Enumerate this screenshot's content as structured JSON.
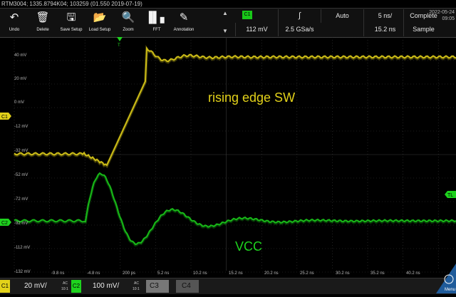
{
  "title_bar": {
    "text": "RTM3004; 1335.8794K04; 103259 (01.550 2019-07-19)"
  },
  "toolbar": {
    "buttons": [
      {
        "label": "Undo",
        "icon": "undo-icon"
      },
      {
        "label": "Delete",
        "icon": "trash-icon"
      },
      {
        "label": "Save Setup",
        "icon": "save-icon"
      },
      {
        "label": "Load Setup",
        "icon": "load-icon"
      },
      {
        "label": "Zoom",
        "icon": "zoom-icon"
      },
      {
        "label": "FFT",
        "icon": "fft-icon"
      },
      {
        "label": "Annotation",
        "icon": "pen-icon"
      }
    ]
  },
  "status": {
    "trigger_channel": "C1",
    "trigger_level": "112 mV",
    "slope_symbol": "∫",
    "sample_rate": "2.5 GSa/s",
    "trigger_mode": "Auto",
    "time_per_div": "5 ns/",
    "time_offset": "15.2 ns",
    "acq_state": "Complete",
    "acq_mode": "Sample",
    "date": "2022-05-24",
    "time": "09:05"
  },
  "scope": {
    "c1_label": "C1",
    "c2_label": "C2",
    "trigger_marker": "TL",
    "annotations": [
      {
        "text": "rising edge SW",
        "color": "#e3d21a"
      },
      {
        "text": "VCC",
        "color": "#1ed21e"
      }
    ],
    "y_labels": [
      "40 mV",
      "20 mV",
      "0 mV",
      "-12 mV",
      "-32 mV",
      "-52 mV",
      "-72 mV",
      "-92 mV",
      "-112 mV",
      "-132 mV"
    ],
    "x_labels": [
      "-9.8 ns",
      "-4.8 ns",
      "200 ps",
      "5.2 ns",
      "10.2 ns",
      "15.2 ns",
      "20.2 ns",
      "25.2 ns",
      "30.2 ns",
      "35.2 ns",
      "40.2 ns"
    ]
  },
  "bottom": {
    "c1": {
      "tag": "C1",
      "scale": "20 mV/",
      "coupling": "AC",
      "bw": "10:1"
    },
    "c2": {
      "tag": "C2",
      "scale": "100 mV/",
      "coupling": "AC",
      "bw": "10:1"
    },
    "c3": {
      "tag": "C3"
    },
    "c4": {
      "tag": "C4"
    },
    "menu": "Menu"
  },
  "colors": {
    "ch1": "#e3d21a",
    "ch2": "#1ed21e",
    "grid": "#3a3a3a"
  }
}
